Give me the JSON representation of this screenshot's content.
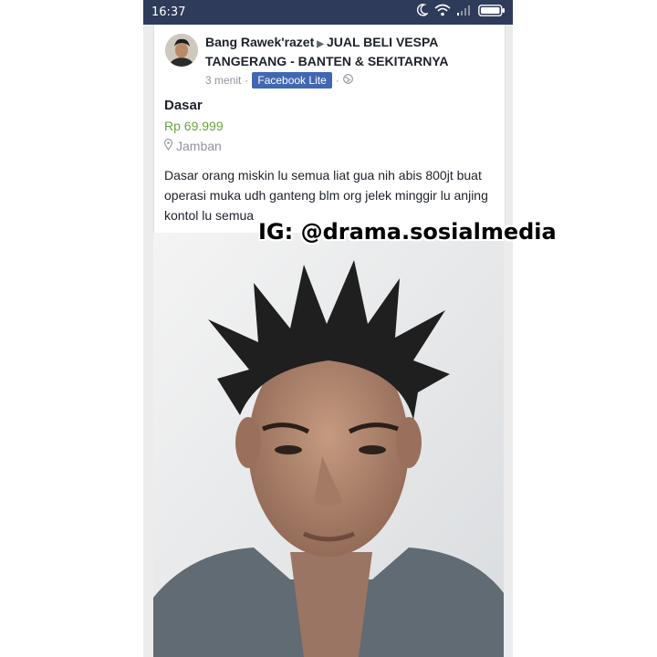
{
  "status_bar": {
    "time": "16:37",
    "icons": [
      "moon-icon",
      "wifi-icon",
      "signal-icon",
      "battery-icon"
    ]
  },
  "post": {
    "author": "Bang Rawek'razet",
    "group": "JUAL BELI VESPA TANGERANG - BANTEN & SEKITARNYA",
    "time_ago": "3 menit",
    "separator": "·",
    "via_badge": "Facebook Lite",
    "privacy_icon": "globe-icon"
  },
  "listing": {
    "title": "Dasar",
    "price": "Rp 69.999",
    "location": "Jamban",
    "description": "Dasar orang miskin lu semua liat gua nih abis 800jt buat operasi muka udh ganteng blm org jelek minggir lu anjing kontol lu semua"
  },
  "watermark": {
    "text": "IG: @drama.sosialmedia"
  },
  "colors": {
    "status_bar": "#2f3b5a",
    "badge": "#4267b2",
    "price": "#6aa33c",
    "muted": "#90949c"
  }
}
